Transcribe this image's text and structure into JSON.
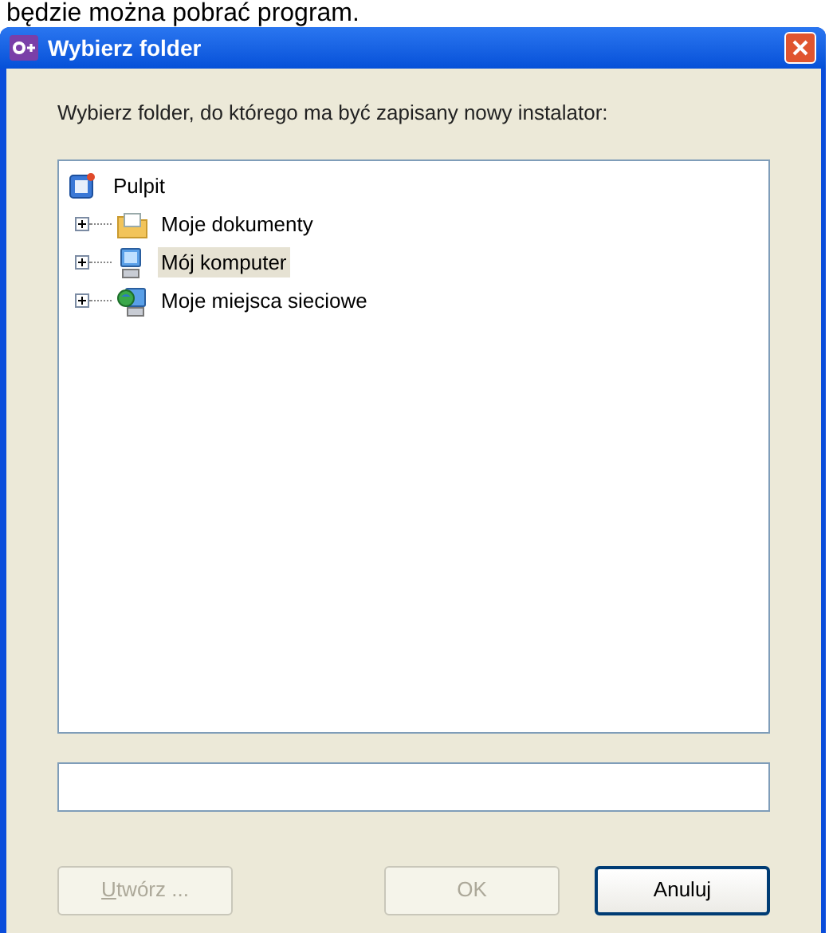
{
  "background_text": "będzie można pobrać program.",
  "window": {
    "title": "Wybierz folder"
  },
  "prompt": "Wybierz folder, do którego ma być zapisany nowy instalator:",
  "tree": {
    "label": "Pulpit",
    "kind": "desktop",
    "expanded": true,
    "selected": false,
    "children": [
      {
        "label": "Moje dokumenty",
        "kind": "documents",
        "expanded": false,
        "selected": false
      },
      {
        "label": "Mój komputer",
        "kind": "computer",
        "expanded": false,
        "selected": true
      },
      {
        "label": "Moje miejsca sieciowe",
        "kind": "network",
        "expanded": false,
        "selected": false
      }
    ]
  },
  "buttons": [
    {
      "label": "Utwórz ...",
      "access_key_underlined": true,
      "disabled": true,
      "default": false
    },
    {
      "label": "OK",
      "disabled": true,
      "default": false
    },
    {
      "label": "Anuluj",
      "disabled": false,
      "default": true
    }
  ]
}
